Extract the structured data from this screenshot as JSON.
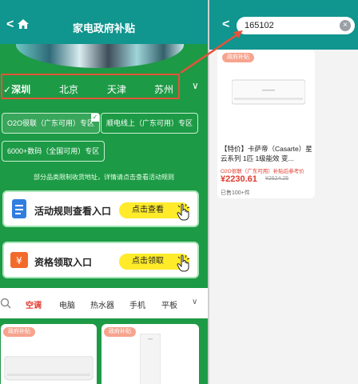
{
  "left": {
    "header": {
      "title": "家电政府补贴",
      "back_icon": "back-icon",
      "home_icon": "home-icon"
    },
    "cities": [
      "深圳",
      "北京",
      "天津",
      "苏州"
    ],
    "active_city": "深圳",
    "tags": [
      "O2O很联（广东可用）专区",
      "顺电线上（广东可用）专区",
      "6000+数码（全国可用）专区"
    ],
    "note": "部分品类限制收货地址，详情请点击查看活动规则",
    "cards": [
      {
        "label": "活动规则查看入口",
        "button": "点击查看"
      },
      {
        "label": "资格领取入口",
        "button": "点击领取"
      }
    ],
    "categories": [
      "空调",
      "电脑",
      "热水器",
      "手机",
      "平板"
    ],
    "active_category": "空调",
    "product_badges": [
      "政府补贴",
      "政府补贴"
    ]
  },
  "right": {
    "search_value": "165102",
    "product": {
      "badge": "政府补贴",
      "name": "【特价】卡萨帝（Casarte）星云系列 1匹 1级能效 变...",
      "sub": "O2O很联（广东可用）补贴后参考价",
      "price": "¥2230.61",
      "old_price": "¥2624.25",
      "sold": "已售100+件"
    }
  },
  "colors": {
    "header": "#10958f",
    "panel_green": "#1d9a45",
    "highlight_red": "#e5533a",
    "price_red": "#e23b2e",
    "button_yellow": "#ffeb2a"
  }
}
